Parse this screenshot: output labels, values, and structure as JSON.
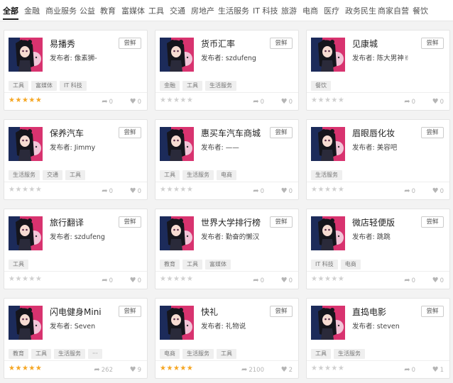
{
  "tabs": [
    "全部",
    "金融",
    "商业服务",
    "公益",
    "教育",
    "富媒体",
    "工具",
    "交通",
    "房地产",
    "生活服务",
    "IT 科技",
    "旅游",
    "电商",
    "医疗",
    "政务民生",
    "商家自营",
    "餐饮"
  ],
  "active_tab": 0,
  "try_label": "尝鲜",
  "publisher_prefix": "发布者: ",
  "colors": {
    "star_on": "#f5a623",
    "star_off": "#cfcfcf",
    "tag_bg": "#efefef"
  },
  "apps": [
    {
      "title": "易播秀",
      "publisher": "像素狮-",
      "tags": [
        "工具",
        "富媒体",
        "IT 科技"
      ],
      "rating": 5,
      "shares": "0",
      "likes": "0"
    },
    {
      "title": "货币汇率",
      "publisher": "szdufeng",
      "tags": [
        "金融",
        "工具",
        "生活服务"
      ],
      "rating": 0,
      "shares": "0",
      "likes": "0"
    },
    {
      "title": "见康城",
      "publisher": "陈大男神✌",
      "tags": [
        "餐饮"
      ],
      "rating": 0,
      "shares": "0",
      "likes": "0"
    },
    {
      "title": "保养汽车",
      "publisher": "Jimmy",
      "tags": [
        "生活服务",
        "交通",
        "工具"
      ],
      "rating": 0,
      "shares": "0",
      "likes": "0"
    },
    {
      "title": "惠买车汽车商城",
      "publisher": "——",
      "tags": [
        "工具",
        "生活服务",
        "电商"
      ],
      "rating": 0,
      "shares": "0",
      "likes": "0"
    },
    {
      "title": "眉眼唇化妆",
      "publisher": "美容吧",
      "tags": [
        "生活服务"
      ],
      "rating": 0,
      "shares": "0",
      "likes": "0"
    },
    {
      "title": "旅行翻译",
      "publisher": "szdufeng",
      "tags": [
        "工具"
      ],
      "rating": 0,
      "shares": "0",
      "likes": "0"
    },
    {
      "title": "世界大学排行榜",
      "publisher": "勤奋的懒汉",
      "tags": [
        "教育",
        "工具",
        "富媒体"
      ],
      "rating": 0,
      "shares": "0",
      "likes": "0"
    },
    {
      "title": "微店轻便版",
      "publisher": "跳跳",
      "tags": [
        "IT 科技",
        "电商"
      ],
      "rating": 0,
      "shares": "0",
      "likes": "0"
    },
    {
      "title": "闪电健身Mini",
      "publisher": "Seven",
      "tags": [
        "教育",
        "工具",
        "生活服务",
        "···"
      ],
      "rating": 5,
      "shares": "262",
      "likes": "9"
    },
    {
      "title": "快礼",
      "publisher": "礼物说",
      "tags": [
        "电商",
        "生活服务",
        "工具"
      ],
      "rating": 5,
      "shares": "2100",
      "likes": "2"
    },
    {
      "title": "直捣电影",
      "publisher": "steven",
      "tags": [
        "工具",
        "生活服务"
      ],
      "rating": 0,
      "shares": "0",
      "likes": "1"
    }
  ]
}
